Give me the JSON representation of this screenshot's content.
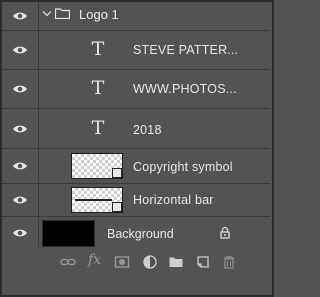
{
  "layers": [
    {
      "kind": "group",
      "name": "Logo 1",
      "visible": true,
      "expanded": true,
      "icon": "folder-icon"
    },
    {
      "kind": "text",
      "type_glyph": "T",
      "name": "STEVE PATTER...",
      "visible": true
    },
    {
      "kind": "text",
      "type_glyph": "T",
      "name": "WWW.PHOTOS...",
      "visible": true
    },
    {
      "kind": "text",
      "type_glyph": "T",
      "name": "2018",
      "visible": true
    },
    {
      "kind": "smart",
      "name": "Copyright symbol",
      "visible": true
    },
    {
      "kind": "smart",
      "name": "Horizontal bar",
      "visible": true
    },
    {
      "kind": "background",
      "name": "Background",
      "visible": true,
      "locked": true
    }
  ],
  "toolbar": {
    "icons": [
      "link-layers-icon",
      "fx-icon",
      "add-mask-icon",
      "adjustment-layer-icon",
      "new-group-icon",
      "new-layer-icon",
      "trash-icon"
    ],
    "fx_label": "fx"
  },
  "colors": {
    "panel": "#535353",
    "divider": "#3a3a3a",
    "text": "#e8e8e8",
    "icon_dim": "#9a9a9a"
  }
}
